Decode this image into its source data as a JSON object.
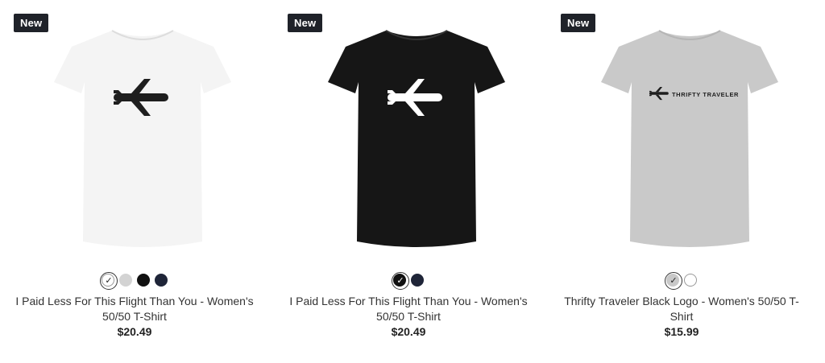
{
  "products": [
    {
      "badge": "New",
      "title": "I Paid Less For This Flight Than You - Women's 50/50 T-Shirt",
      "price": "$20.49",
      "shirt_color": "#f4f4f4",
      "logo_color": "#1e1e1e",
      "logo_text": "",
      "swatches": [
        {
          "color": "#ffffff",
          "selected": true
        },
        {
          "color": "#d3d3d3",
          "selected": false
        },
        {
          "color": "#111111",
          "selected": false
        },
        {
          "color": "#1f2538",
          "selected": false
        }
      ]
    },
    {
      "badge": "New",
      "title": "I Paid Less For This Flight Than You - Women's 50/50 T-Shirt",
      "price": "$20.49",
      "shirt_color": "#161616",
      "logo_color": "#ffffff",
      "logo_text": "",
      "swatches": [
        {
          "color": "#111111",
          "selected": true
        },
        {
          "color": "#1f2538",
          "selected": false
        }
      ]
    },
    {
      "badge": "New",
      "title": "Thrifty Traveler Black Logo - Women's 50/50 T-Shirt",
      "price": "$15.99",
      "shirt_color": "#c9c9c9",
      "logo_color": "#1e1e1e",
      "logo_text": "THRIFTY TRAVELER",
      "swatches": [
        {
          "color": "#c8c8c8",
          "selected": true
        },
        {
          "color": "#ffffff",
          "selected": false
        }
      ]
    }
  ]
}
